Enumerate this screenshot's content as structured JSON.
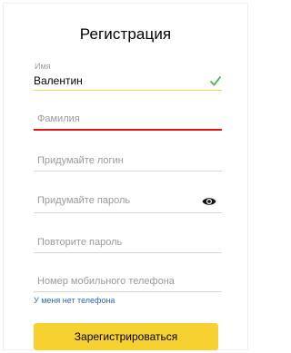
{
  "form": {
    "title": "Регистрация",
    "first_name": {
      "label": "Имя",
      "value": "Валентин",
      "status": "valid"
    },
    "last_name": {
      "placeholder": "Фамилия",
      "status": "error"
    },
    "login": {
      "placeholder": "Придумайте логин"
    },
    "password": {
      "placeholder": "Придумайте пароль",
      "toggle_icon": "eye-icon"
    },
    "password_repeat": {
      "placeholder": "Повторите пароль"
    },
    "phone": {
      "placeholder": "Номер мобильного телефона"
    },
    "no_phone_link": "У меня нет телефона",
    "submit_label": "Зарегистрироваться"
  },
  "colors": {
    "accent": "#f7d12f",
    "valid": "#4caf50",
    "error": "#e7131a",
    "link": "#2f67c8"
  }
}
